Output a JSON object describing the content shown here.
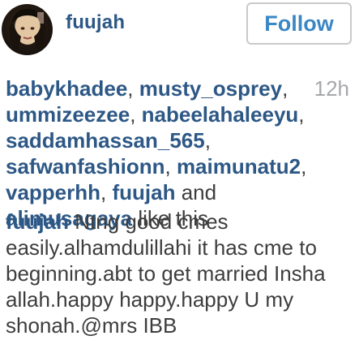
{
  "header": {
    "username": "fuujah",
    "follow_label": "Follow"
  },
  "likes": {
    "users": [
      "babykhadee",
      "musty_osprey",
      "ummizeezee",
      "nabeelahaleeyu",
      "saddamhassan_565",
      "safwanfashionn",
      "maimunatu2",
      "vapperhh",
      "fuujah",
      "alimusagaya"
    ],
    "and_text": "and",
    "suffix": "like this",
    "timestamp": "12h"
  },
  "comment": {
    "author": "fuujah",
    "text": "Ntng good cmes easily.alhamdulillahi it has cme to beginning.abt to get married Insha allah.happy happy.happy U my shonah.@mrs IBB"
  },
  "colors": {
    "link": "#2d5886",
    "follow_text": "#3b86c4",
    "body_text": "#3d3d3d",
    "timestamp": "#a5a7aa"
  }
}
